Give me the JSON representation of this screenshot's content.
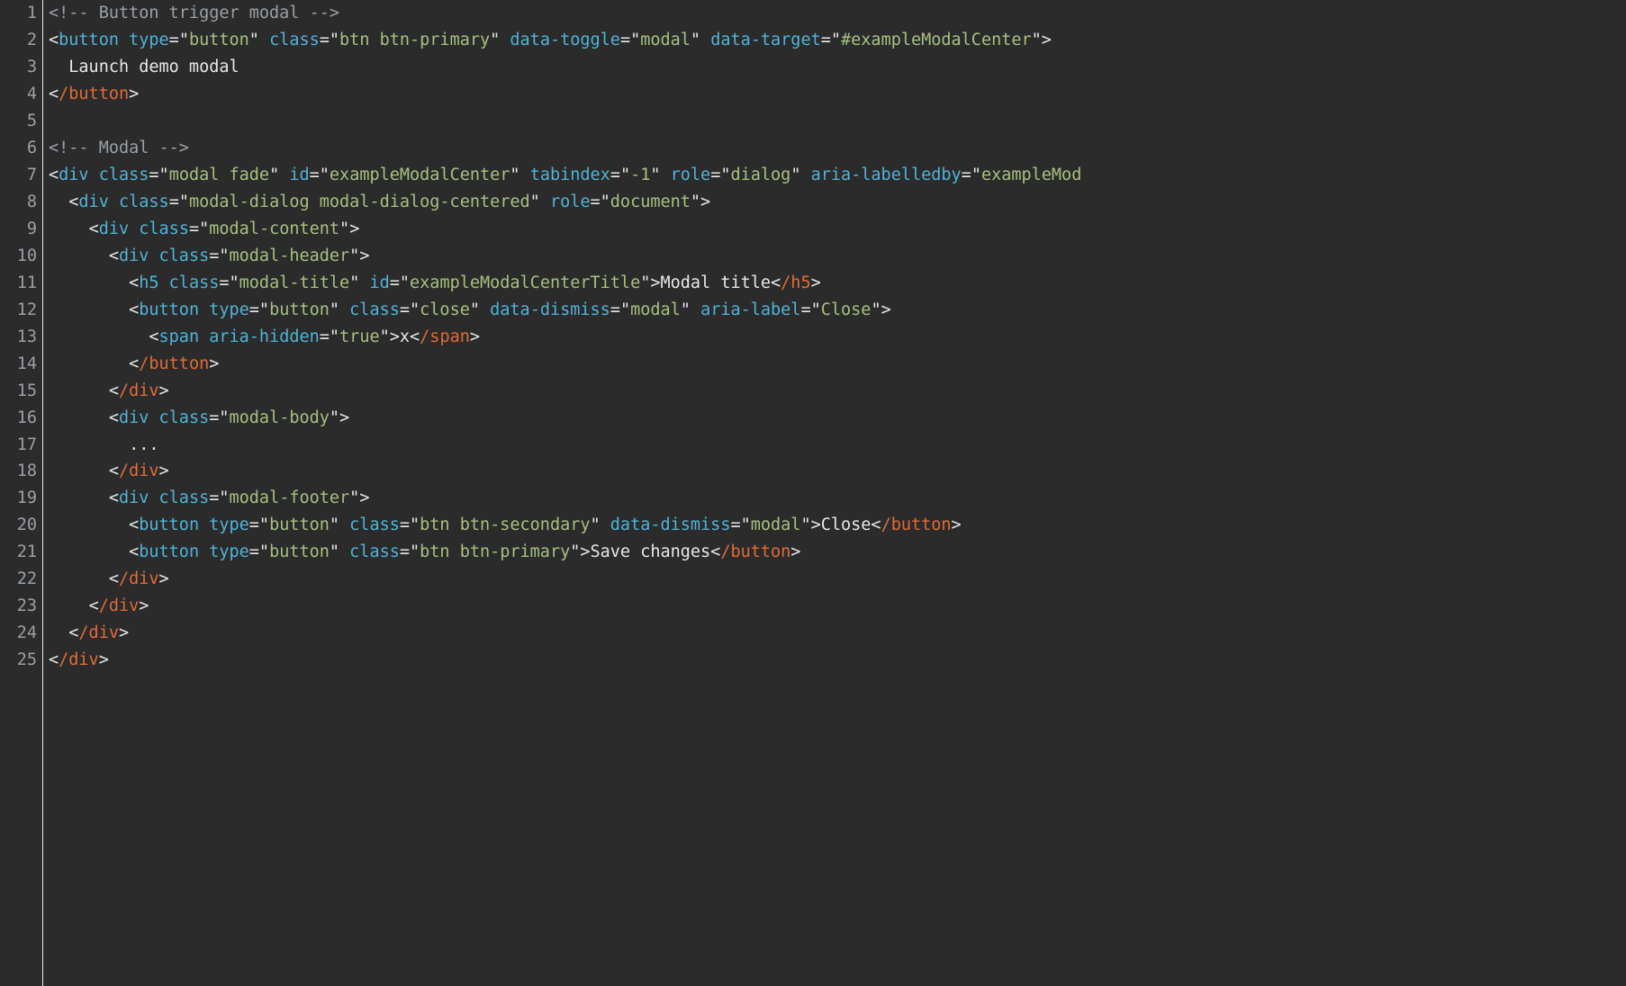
{
  "lineCount": 25,
  "code": {
    "l1": [
      [
        "comment",
        "<!-- Button trigger modal -->"
      ]
    ],
    "l2": [
      [
        "punct",
        "<"
      ],
      [
        "tag",
        "button"
      ],
      [
        "text",
        " "
      ],
      [
        "attr",
        "type"
      ],
      [
        "punct",
        "="
      ],
      [
        "punct",
        "\""
      ],
      [
        "val",
        "button"
      ],
      [
        "punct",
        "\""
      ],
      [
        "text",
        " "
      ],
      [
        "attr",
        "class"
      ],
      [
        "punct",
        "="
      ],
      [
        "punct",
        "\""
      ],
      [
        "val",
        "btn btn-primary"
      ],
      [
        "punct",
        "\""
      ],
      [
        "text",
        " "
      ],
      [
        "attr",
        "data-toggle"
      ],
      [
        "punct",
        "="
      ],
      [
        "punct",
        "\""
      ],
      [
        "val",
        "modal"
      ],
      [
        "punct",
        "\""
      ],
      [
        "text",
        " "
      ],
      [
        "attr",
        "data-target"
      ],
      [
        "punct",
        "="
      ],
      [
        "punct",
        "\""
      ],
      [
        "val",
        "#exampleModalCenter"
      ],
      [
        "punct",
        "\""
      ],
      [
        "punct",
        ">"
      ]
    ],
    "l3": [
      [
        "text",
        "  Launch demo modal"
      ]
    ],
    "l4": [
      [
        "punct",
        "<"
      ],
      [
        "tagc",
        "/button"
      ],
      [
        "punct",
        ">"
      ]
    ],
    "l5": [
      [
        "text",
        ""
      ]
    ],
    "l6": [
      [
        "comment",
        "<!-- Modal -->"
      ]
    ],
    "l7": [
      [
        "punct",
        "<"
      ],
      [
        "tag",
        "div"
      ],
      [
        "text",
        " "
      ],
      [
        "attr",
        "class"
      ],
      [
        "punct",
        "="
      ],
      [
        "punct",
        "\""
      ],
      [
        "val",
        "modal fade"
      ],
      [
        "punct",
        "\""
      ],
      [
        "text",
        " "
      ],
      [
        "attr",
        "id"
      ],
      [
        "punct",
        "="
      ],
      [
        "punct",
        "\""
      ],
      [
        "val",
        "exampleModalCenter"
      ],
      [
        "punct",
        "\""
      ],
      [
        "text",
        " "
      ],
      [
        "attr",
        "tabindex"
      ],
      [
        "punct",
        "="
      ],
      [
        "punct",
        "\""
      ],
      [
        "val",
        "-1"
      ],
      [
        "punct",
        "\""
      ],
      [
        "text",
        " "
      ],
      [
        "attr",
        "role"
      ],
      [
        "punct",
        "="
      ],
      [
        "punct",
        "\""
      ],
      [
        "val",
        "dialog"
      ],
      [
        "punct",
        "\""
      ],
      [
        "text",
        " "
      ],
      [
        "attr",
        "aria-labelledby"
      ],
      [
        "punct",
        "="
      ],
      [
        "punct",
        "\""
      ],
      [
        "val",
        "exampleMod"
      ]
    ],
    "l8": [
      [
        "text",
        "  "
      ],
      [
        "punct",
        "<"
      ],
      [
        "tag",
        "div"
      ],
      [
        "text",
        " "
      ],
      [
        "attr",
        "class"
      ],
      [
        "punct",
        "="
      ],
      [
        "punct",
        "\""
      ],
      [
        "val",
        "modal-dialog modal-dialog-centered"
      ],
      [
        "punct",
        "\""
      ],
      [
        "text",
        " "
      ],
      [
        "attr",
        "role"
      ],
      [
        "punct",
        "="
      ],
      [
        "punct",
        "\""
      ],
      [
        "val",
        "document"
      ],
      [
        "punct",
        "\""
      ],
      [
        "punct",
        ">"
      ]
    ],
    "l9": [
      [
        "text",
        "    "
      ],
      [
        "punct",
        "<"
      ],
      [
        "tag",
        "div"
      ],
      [
        "text",
        " "
      ],
      [
        "attr",
        "class"
      ],
      [
        "punct",
        "="
      ],
      [
        "punct",
        "\""
      ],
      [
        "val",
        "modal-content"
      ],
      [
        "punct",
        "\""
      ],
      [
        "punct",
        ">"
      ]
    ],
    "l10": [
      [
        "text",
        "      "
      ],
      [
        "punct",
        "<"
      ],
      [
        "tag",
        "div"
      ],
      [
        "text",
        " "
      ],
      [
        "attr",
        "class"
      ],
      [
        "punct",
        "="
      ],
      [
        "punct",
        "\""
      ],
      [
        "val",
        "modal-header"
      ],
      [
        "punct",
        "\""
      ],
      [
        "punct",
        ">"
      ]
    ],
    "l11": [
      [
        "text",
        "        "
      ],
      [
        "punct",
        "<"
      ],
      [
        "tag",
        "h5"
      ],
      [
        "text",
        " "
      ],
      [
        "attr",
        "class"
      ],
      [
        "punct",
        "="
      ],
      [
        "punct",
        "\""
      ],
      [
        "val",
        "modal-title"
      ],
      [
        "punct",
        "\""
      ],
      [
        "text",
        " "
      ],
      [
        "attr",
        "id"
      ],
      [
        "punct",
        "="
      ],
      [
        "punct",
        "\""
      ],
      [
        "val",
        "exampleModalCenterTitle"
      ],
      [
        "punct",
        "\""
      ],
      [
        "punct",
        ">"
      ],
      [
        "text",
        "Modal title"
      ],
      [
        "punct",
        "<"
      ],
      [
        "tagc",
        "/h5"
      ],
      [
        "punct",
        ">"
      ]
    ],
    "l12": [
      [
        "text",
        "        "
      ],
      [
        "punct",
        "<"
      ],
      [
        "tag",
        "button"
      ],
      [
        "text",
        " "
      ],
      [
        "attr",
        "type"
      ],
      [
        "punct",
        "="
      ],
      [
        "punct",
        "\""
      ],
      [
        "val",
        "button"
      ],
      [
        "punct",
        "\""
      ],
      [
        "text",
        " "
      ],
      [
        "attr",
        "class"
      ],
      [
        "punct",
        "="
      ],
      [
        "punct",
        "\""
      ],
      [
        "val",
        "close"
      ],
      [
        "punct",
        "\""
      ],
      [
        "text",
        " "
      ],
      [
        "attr",
        "data-dismiss"
      ],
      [
        "punct",
        "="
      ],
      [
        "punct",
        "\""
      ],
      [
        "val",
        "modal"
      ],
      [
        "punct",
        "\""
      ],
      [
        "text",
        " "
      ],
      [
        "attr",
        "aria-label"
      ],
      [
        "punct",
        "="
      ],
      [
        "punct",
        "\""
      ],
      [
        "val",
        "Close"
      ],
      [
        "punct",
        "\""
      ],
      [
        "punct",
        ">"
      ]
    ],
    "l13": [
      [
        "text",
        "          "
      ],
      [
        "punct",
        "<"
      ],
      [
        "tag",
        "span"
      ],
      [
        "text",
        " "
      ],
      [
        "attr",
        "aria-hidden"
      ],
      [
        "punct",
        "="
      ],
      [
        "punct",
        "\""
      ],
      [
        "val",
        "true"
      ],
      [
        "punct",
        "\""
      ],
      [
        "punct",
        ">"
      ],
      [
        "text",
        "x"
      ],
      [
        "punct",
        "<"
      ],
      [
        "tagc",
        "/span"
      ],
      [
        "punct",
        ">"
      ]
    ],
    "l14": [
      [
        "text",
        "        "
      ],
      [
        "punct",
        "<"
      ],
      [
        "tagc",
        "/button"
      ],
      [
        "punct",
        ">"
      ]
    ],
    "l15": [
      [
        "text",
        "      "
      ],
      [
        "punct",
        "<"
      ],
      [
        "tagc",
        "/div"
      ],
      [
        "punct",
        ">"
      ]
    ],
    "l16": [
      [
        "text",
        "      "
      ],
      [
        "punct",
        "<"
      ],
      [
        "tag",
        "div"
      ],
      [
        "text",
        " "
      ],
      [
        "attr",
        "class"
      ],
      [
        "punct",
        "="
      ],
      [
        "punct",
        "\""
      ],
      [
        "val",
        "modal-body"
      ],
      [
        "punct",
        "\""
      ],
      [
        "punct",
        ">"
      ]
    ],
    "l17": [
      [
        "text",
        "        ..."
      ]
    ],
    "l18": [
      [
        "text",
        "      "
      ],
      [
        "punct",
        "<"
      ],
      [
        "tagc",
        "/div"
      ],
      [
        "punct",
        ">"
      ]
    ],
    "l19": [
      [
        "text",
        "      "
      ],
      [
        "punct",
        "<"
      ],
      [
        "tag",
        "div"
      ],
      [
        "text",
        " "
      ],
      [
        "attr",
        "class"
      ],
      [
        "punct",
        "="
      ],
      [
        "punct",
        "\""
      ],
      [
        "val",
        "modal-footer"
      ],
      [
        "punct",
        "\""
      ],
      [
        "punct",
        ">"
      ]
    ],
    "l20": [
      [
        "text",
        "        "
      ],
      [
        "punct",
        "<"
      ],
      [
        "tag",
        "button"
      ],
      [
        "text",
        " "
      ],
      [
        "attr",
        "type"
      ],
      [
        "punct",
        "="
      ],
      [
        "punct",
        "\""
      ],
      [
        "val",
        "button"
      ],
      [
        "punct",
        "\""
      ],
      [
        "text",
        " "
      ],
      [
        "attr",
        "class"
      ],
      [
        "punct",
        "="
      ],
      [
        "punct",
        "\""
      ],
      [
        "val",
        "btn btn-secondary"
      ],
      [
        "punct",
        "\""
      ],
      [
        "text",
        " "
      ],
      [
        "attr",
        "data-dismiss"
      ],
      [
        "punct",
        "="
      ],
      [
        "punct",
        "\""
      ],
      [
        "val",
        "modal"
      ],
      [
        "punct",
        "\""
      ],
      [
        "punct",
        ">"
      ],
      [
        "text",
        "Close"
      ],
      [
        "punct",
        "<"
      ],
      [
        "tagc",
        "/button"
      ],
      [
        "punct",
        ">"
      ]
    ],
    "l21": [
      [
        "text",
        "        "
      ],
      [
        "punct",
        "<"
      ],
      [
        "tag",
        "button"
      ],
      [
        "text",
        " "
      ],
      [
        "attr",
        "type"
      ],
      [
        "punct",
        "="
      ],
      [
        "punct",
        "\""
      ],
      [
        "val",
        "button"
      ],
      [
        "punct",
        "\""
      ],
      [
        "text",
        " "
      ],
      [
        "attr",
        "class"
      ],
      [
        "punct",
        "="
      ],
      [
        "punct",
        "\""
      ],
      [
        "val",
        "btn btn-primary"
      ],
      [
        "punct",
        "\""
      ],
      [
        "punct",
        ">"
      ],
      [
        "text",
        "Save changes"
      ],
      [
        "punct",
        "<"
      ],
      [
        "tagc",
        "/button"
      ],
      [
        "punct",
        ">"
      ]
    ],
    "l22": [
      [
        "text",
        "      "
      ],
      [
        "punct",
        "<"
      ],
      [
        "tagc",
        "/div"
      ],
      [
        "punct",
        ">"
      ]
    ],
    "l23": [
      [
        "text",
        "    "
      ],
      [
        "punct",
        "<"
      ],
      [
        "tagc",
        "/div"
      ],
      [
        "punct",
        ">"
      ]
    ],
    "l24": [
      [
        "text",
        "  "
      ],
      [
        "punct",
        "<"
      ],
      [
        "tagc",
        "/div"
      ],
      [
        "punct",
        ">"
      ]
    ],
    "l25": [
      [
        "punct",
        "<"
      ],
      [
        "tagc",
        "/div"
      ],
      [
        "punct",
        ">"
      ]
    ]
  }
}
